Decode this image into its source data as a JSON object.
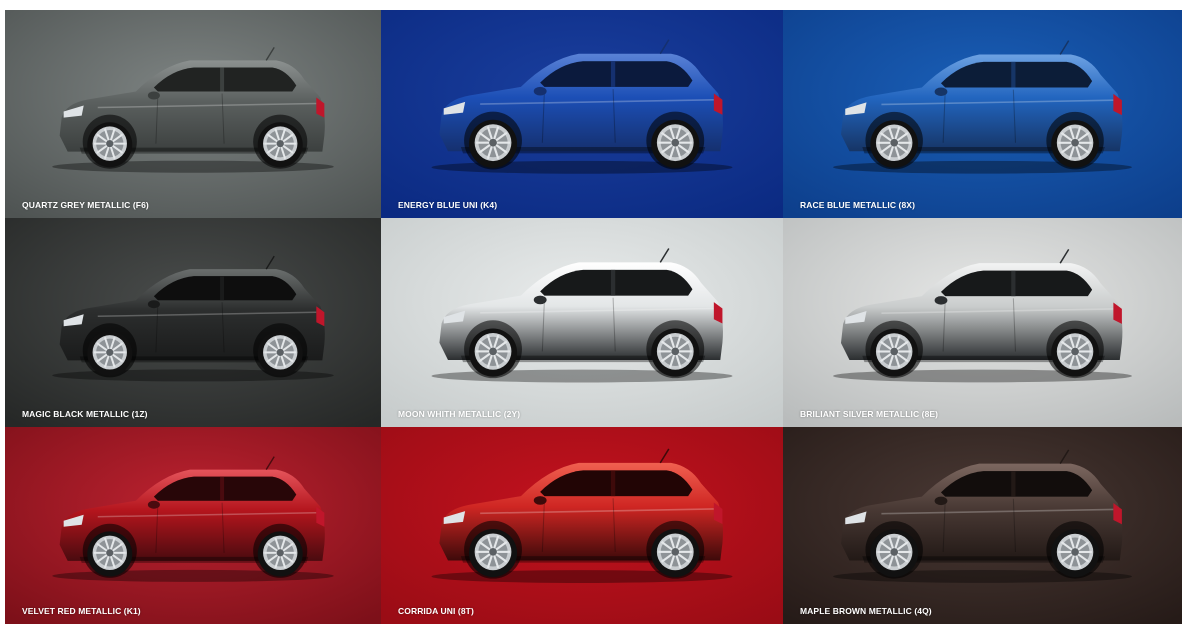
{
  "colors": [
    {
      "label": "QUARTZ GREY METALLIC (F6)",
      "bg_top": "#7e8483",
      "bg_bottom": "#4f5453",
      "body": "#5b605f",
      "roof": "#3c403f",
      "shine": "#8c9190",
      "icon": "car-icon"
    },
    {
      "label": "ENERGY BLUE UNI (K4)",
      "bg_top": "#1a3f9e",
      "bg_bottom": "#0b2a82",
      "body": "#1c4fb6",
      "roof": "#15306f",
      "shine": "#5a82d6",
      "icon": "car-icon"
    },
    {
      "label": "RACE BLUE METALLIC (8X)",
      "bg_top": "#1a5fb7",
      "bg_bottom": "#0d3f8c",
      "body": "#2265bf",
      "roof": "#163566",
      "shine": "#6da2e3",
      "icon": "car-icon"
    },
    {
      "label": "MAGIC BLACK METALLIC (1Z)",
      "bg_top": "#4a4d4c",
      "bg_bottom": "#262827",
      "body": "#2c2e2e",
      "roof": "#1a1b1b",
      "shine": "#6a6e6d",
      "icon": "car-icon"
    },
    {
      "label": "MOON WHITH METALLIC (2Y)",
      "bg_top": "#e9ecec",
      "bg_bottom": "#c6cbcb",
      "body": "#e3e6e7",
      "roof": "#2b2e30",
      "shine": "#ffffff",
      "icon": "car-icon"
    },
    {
      "label": "BRILIANT SILVER METALLIC (8E)",
      "bg_top": "#e6e7e6",
      "bg_bottom": "#b9bcbc",
      "body": "#c9cccc",
      "roof": "#2b2e30",
      "shine": "#f2f3f3",
      "icon": "car-icon"
    },
    {
      "label": "VELVET RED METALLIC (K1)",
      "bg_top": "#bd2230",
      "bg_bottom": "#7d1019",
      "body": "#b4151d",
      "roof": "#4a0b0f",
      "shine": "#e5545b",
      "icon": "car-icon"
    },
    {
      "label": "CORRIDA UNI (8T)",
      "bg_top": "#c3121e",
      "bg_bottom": "#9a0c15",
      "body": "#cf2623",
      "roof": "#3e0a0a",
      "shine": "#f06050",
      "icon": "car-icon"
    },
    {
      "label": "MAPLE BROWN METALLIC (4Q)",
      "bg_top": "#4a3934",
      "bg_bottom": "#261b18",
      "body": "#4a3a35",
      "roof": "#221916",
      "shine": "#7c6760",
      "icon": "car-icon"
    }
  ]
}
